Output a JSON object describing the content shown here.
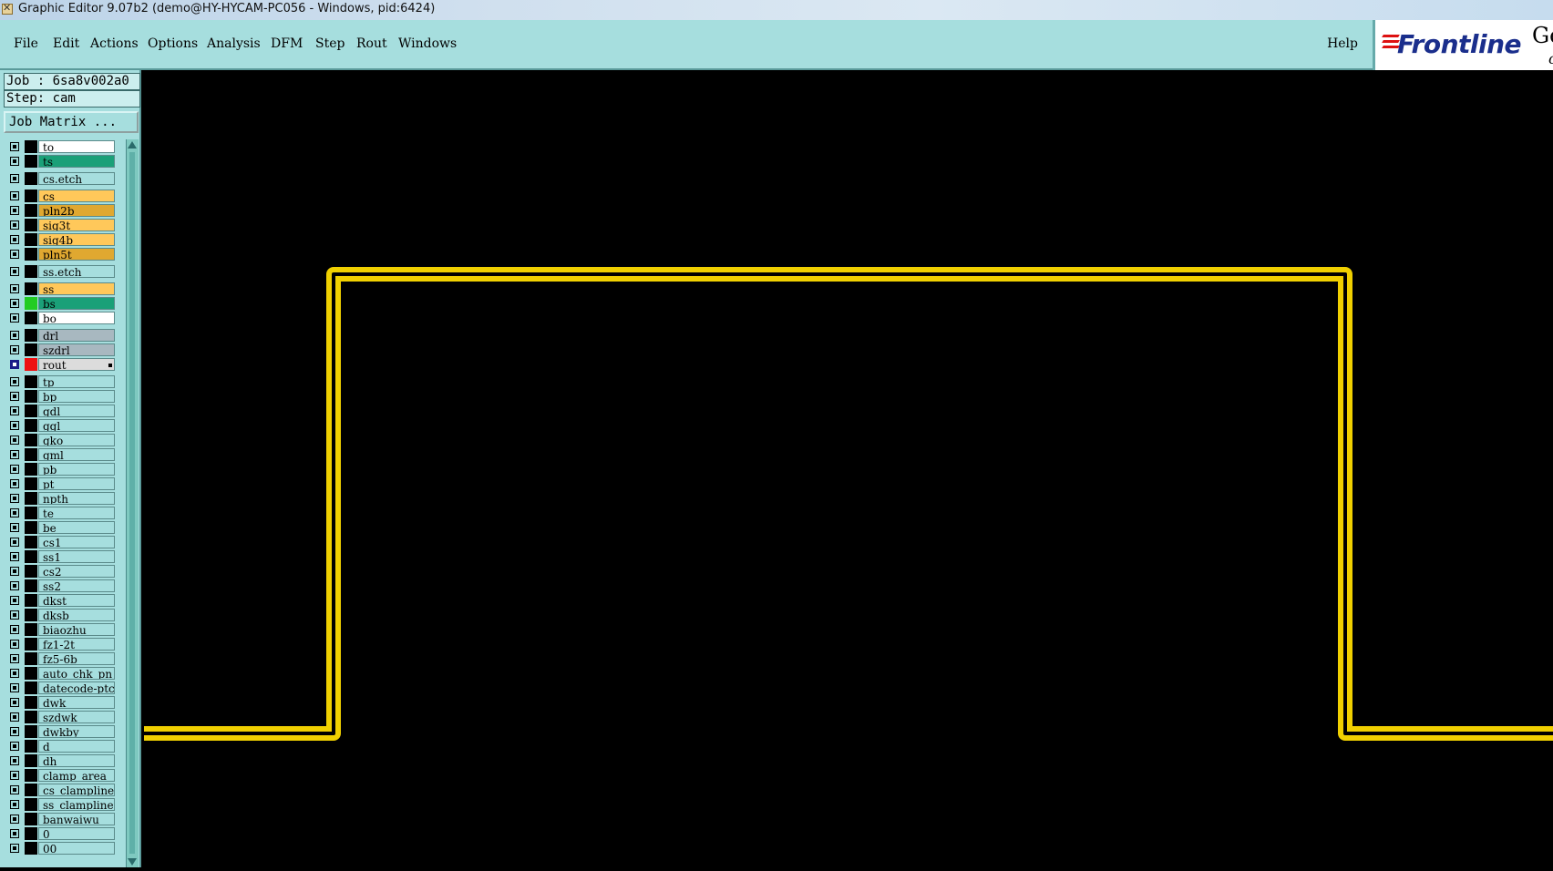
{
  "window": {
    "title": "Graphic Editor 9.07b2 (demo@HY-HYCAM-PC056 - Windows, pid:6424)"
  },
  "menu": {
    "items": [
      {
        "id": "file",
        "label": "File"
      },
      {
        "id": "edit",
        "label": "Edit"
      },
      {
        "id": "actions",
        "label": "Actions"
      },
      {
        "id": "options",
        "label": "Options"
      },
      {
        "id": "analysis",
        "label": "Analysis"
      },
      {
        "id": "dfm",
        "label": "DFM"
      },
      {
        "id": "step",
        "label": "Step"
      },
      {
        "id": "rout",
        "label": "Rout"
      },
      {
        "id": "windows",
        "label": "Windows"
      }
    ],
    "help": "Help"
  },
  "logo": {
    "brand": "Frontline",
    "tail": "Ge",
    "sub": "c"
  },
  "panel": {
    "job": "Job : 6sa8v002a0",
    "step": "Step: cam",
    "job_matrix": "Job Matrix ..."
  },
  "layers": [
    {
      "name": "to",
      "color": "#ffffff",
      "swatch": "#000000"
    },
    {
      "name": "ts",
      "color": "#1aa078",
      "swatch": "#000000"
    },
    {
      "name": "cs.etch",
      "color": "#a6dede",
      "swatch": "#000000",
      "gap": true
    },
    {
      "name": "cs",
      "color": "#ffc85a",
      "swatch": "#000000",
      "gap": true
    },
    {
      "name": "pln2b",
      "color": "#e0a830",
      "swatch": "#000000"
    },
    {
      "name": "sig3t",
      "color": "#ffc85a",
      "swatch": "#000000"
    },
    {
      "name": "sig4b",
      "color": "#ffc85a",
      "swatch": "#000000"
    },
    {
      "name": "pln5t",
      "color": "#e0a830",
      "swatch": "#000000"
    },
    {
      "name": "ss.etch",
      "color": "#a6dede",
      "swatch": "#000000",
      "gap": true
    },
    {
      "name": "ss",
      "color": "#ffc85a",
      "swatch": "#000000",
      "gap": true
    },
    {
      "name": "bs",
      "color": "#1aa078",
      "swatch": "#22cc22"
    },
    {
      "name": "bo",
      "color": "#ffffff",
      "swatch": "#000000"
    },
    {
      "name": "drl",
      "color": "#a8b8c0",
      "swatch": "#000000",
      "gap": true
    },
    {
      "name": "szdrl",
      "color": "#a8b8c0",
      "swatch": "#000000"
    },
    {
      "name": "rout",
      "color": "#dcdcdc",
      "swatch": "#ee1111",
      "active": true
    },
    {
      "name": "tp",
      "color": "#a6dede",
      "swatch": "#000000",
      "gap": true
    },
    {
      "name": "bp",
      "color": "#a6dede",
      "swatch": "#000000"
    },
    {
      "name": "gdl",
      "color": "#a6dede",
      "swatch": "#000000"
    },
    {
      "name": "ggl",
      "color": "#a6dede",
      "swatch": "#000000"
    },
    {
      "name": "gko",
      "color": "#a6dede",
      "swatch": "#000000"
    },
    {
      "name": "gml",
      "color": "#a6dede",
      "swatch": "#000000"
    },
    {
      "name": "pb",
      "color": "#a6dede",
      "swatch": "#000000"
    },
    {
      "name": "pt",
      "color": "#a6dede",
      "swatch": "#000000"
    },
    {
      "name": "npth",
      "color": "#a6dede",
      "swatch": "#000000"
    },
    {
      "name": "te",
      "color": "#a6dede",
      "swatch": "#000000"
    },
    {
      "name": "be",
      "color": "#a6dede",
      "swatch": "#000000"
    },
    {
      "name": "cs1",
      "color": "#a6dede",
      "swatch": "#000000"
    },
    {
      "name": "ss1",
      "color": "#a6dede",
      "swatch": "#000000"
    },
    {
      "name": "cs2",
      "color": "#a6dede",
      "swatch": "#000000"
    },
    {
      "name": "ss2",
      "color": "#a6dede",
      "swatch": "#000000"
    },
    {
      "name": "dkst",
      "color": "#a6dede",
      "swatch": "#000000"
    },
    {
      "name": "dksb",
      "color": "#a6dede",
      "swatch": "#000000"
    },
    {
      "name": "biaozhu",
      "color": "#a6dede",
      "swatch": "#000000"
    },
    {
      "name": "fz1-2t",
      "color": "#a6dede",
      "swatch": "#000000"
    },
    {
      "name": "fz5-6b",
      "color": "#a6dede",
      "swatch": "#000000"
    },
    {
      "name": "auto_chk_pn",
      "color": "#a6dede",
      "swatch": "#000000"
    },
    {
      "name": "datecode-ptc",
      "color": "#a6dede",
      "swatch": "#000000"
    },
    {
      "name": "dwk",
      "color": "#a6dede",
      "swatch": "#000000"
    },
    {
      "name": "szdwk",
      "color": "#a6dede",
      "swatch": "#000000"
    },
    {
      "name": "dwkby",
      "color": "#a6dede",
      "swatch": "#000000"
    },
    {
      "name": "d",
      "color": "#a6dede",
      "swatch": "#000000"
    },
    {
      "name": "dh",
      "color": "#a6dede",
      "swatch": "#000000"
    },
    {
      "name": "clamp_area",
      "color": "#a6dede",
      "swatch": "#000000"
    },
    {
      "name": "cs_clampline",
      "color": "#a6dede",
      "swatch": "#000000"
    },
    {
      "name": "ss_clampline",
      "color": "#a6dede",
      "swatch": "#000000"
    },
    {
      "name": "banwaiwu",
      "color": "#a6dede",
      "swatch": "#000000"
    },
    {
      "name": "0",
      "color": "#a6dede",
      "swatch": "#000000"
    },
    {
      "name": "00",
      "color": "#a6dede",
      "swatch": "#000000"
    }
  ],
  "graphic": {
    "trace_color": "#f0d000"
  }
}
